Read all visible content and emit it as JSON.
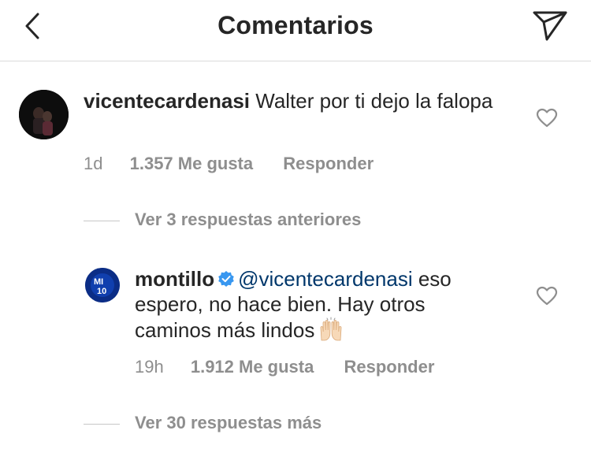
{
  "header": {
    "title": "Comentarios"
  },
  "comment": {
    "username": "vicentecardenasi",
    "text": "Walter por ti dejo la falopa",
    "time": "1d",
    "likes": "1.357 Me gusta",
    "reply": "Responder"
  },
  "previous_replies": "Ver 3 respuestas anteriores",
  "reply_comment": {
    "username": "montillo",
    "mention": "@vicentecardenasi",
    "text": "eso espero, no hace bien. Hay otros caminos más lindos",
    "time": "19h",
    "likes": "1.912 Me gusta",
    "reply": "Responder"
  },
  "more_replies": "Ver 30 respuestas más",
  "colors": {
    "verified": "#3897f0",
    "mention": "#00376b",
    "meta": "#8e8e8e"
  }
}
